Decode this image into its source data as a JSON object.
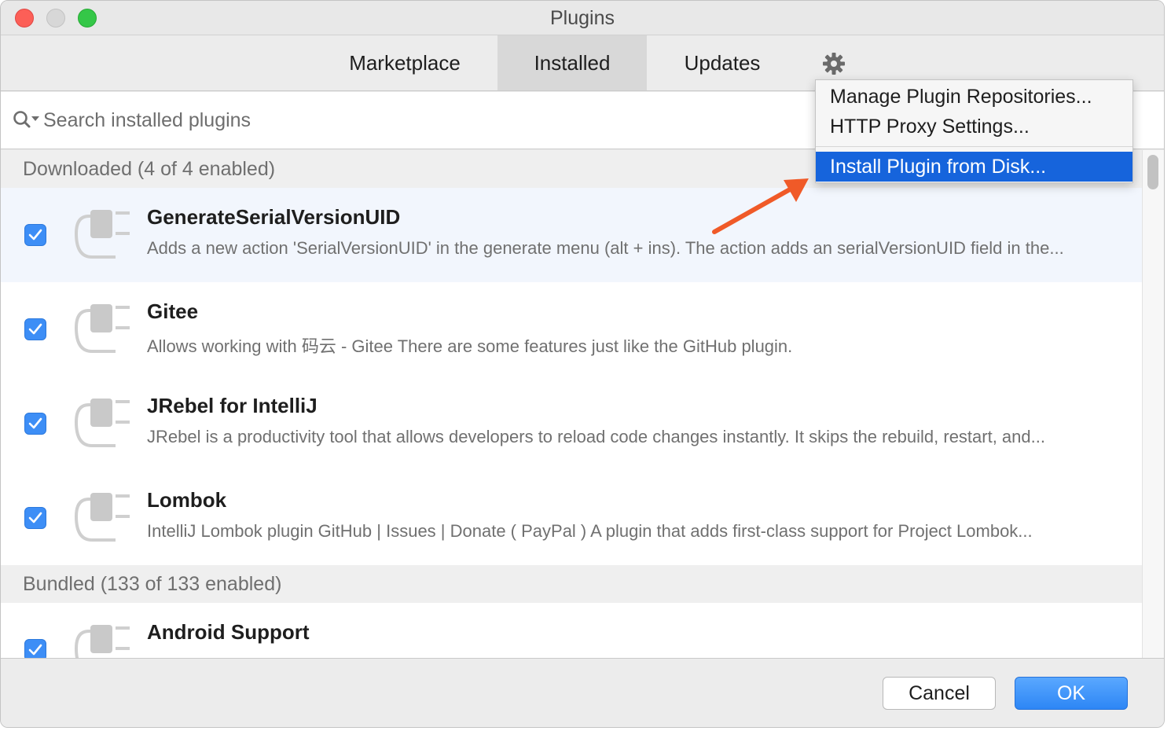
{
  "window": {
    "title": "Plugins"
  },
  "tabs": [
    {
      "label": "Marketplace"
    },
    {
      "label": "Installed"
    },
    {
      "label": "Updates"
    }
  ],
  "search": {
    "placeholder": "Search installed plugins",
    "value": ""
  },
  "sections": {
    "downloaded": "Downloaded (4 of 4 enabled)",
    "bundled": "Bundled (133 of 133 enabled)"
  },
  "plugins": [
    {
      "name": "GenerateSerialVersionUID",
      "description": "Adds a new action 'SerialVersionUID' in the generate menu (alt + ins). The action adds an serialVersionUID field in the...",
      "enabled": true
    },
    {
      "name": "Gitee",
      "description": "Allows working with 码云 - Gitee There are some features just like the GitHub plugin.",
      "enabled": true
    },
    {
      "name": "JRebel for IntelliJ",
      "description": "JRebel is a productivity tool that allows developers to reload code changes instantly. It skips the rebuild, restart, and...",
      "enabled": true
    },
    {
      "name": "Lombok",
      "description": "IntelliJ Lombok plugin GitHub | Issues | Donate ( PayPal ) A plugin that adds first-class support for Project Lombok...",
      "enabled": true
    },
    {
      "name": "Android Support",
      "description": "",
      "enabled": true
    }
  ],
  "menu": {
    "items": [
      {
        "label": "Manage Plugin Repositories..."
      },
      {
        "label": "HTTP Proxy Settings..."
      },
      {
        "label": "Install Plugin from Disk...",
        "highlighted": true
      }
    ]
  },
  "buttons": {
    "cancel": "Cancel",
    "ok": "OK"
  },
  "colors": {
    "accent": "#1664dc",
    "checkbox": "#3d8ef6",
    "annotation_arrow": "#f05a28"
  },
  "icons": [
    "gear-icon",
    "search-icon",
    "plugin-icon",
    "checkmark-icon",
    "annotation-arrow"
  ]
}
